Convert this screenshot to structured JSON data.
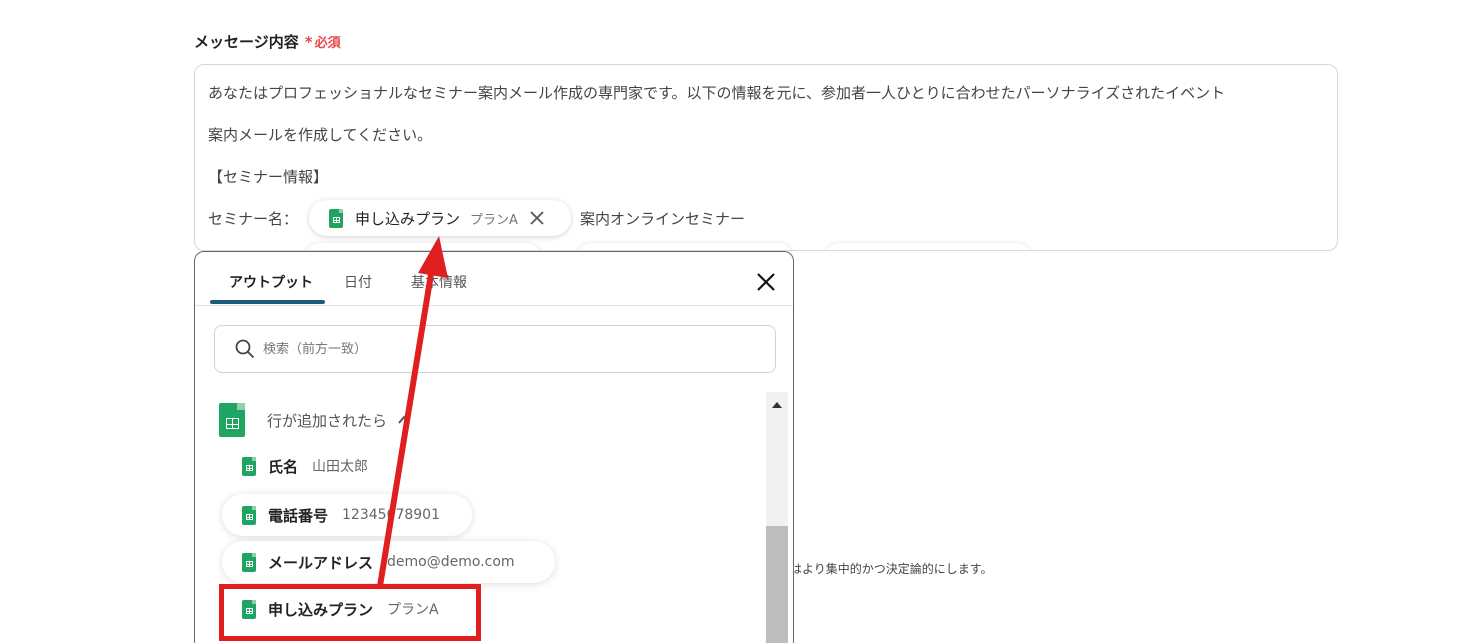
{
  "field": {
    "label": "メッセージ内容",
    "required_star": "*",
    "required_text": "必須"
  },
  "message": {
    "line1": "あなたはプロフェッショナルなセミナー案内メール作成の専門家です。以下の情報を元に、参加者一人ひとりに合わせたパーソナライズされたイベント",
    "line2": "案内メールを作成してください。",
    "line3": "【セミナー情報】",
    "line4_prefix": "セミナー名：",
    "chip": {
      "label": "申し込みプラン",
      "value": "プランA"
    },
    "line4_suffix": "案内オンラインセミナー"
  },
  "popup": {
    "tabs": [
      "アウトプット",
      "日付",
      "基本情報"
    ],
    "active_tab": 0,
    "search_placeholder": "検索（前方一致）",
    "group_title": "行が追加されたら",
    "items": [
      {
        "label": "氏名",
        "value": "山田太郎"
      },
      {
        "label": "電話番号",
        "value": "12345678901"
      },
      {
        "label": "メールアドレス",
        "value": "demo@demo.com"
      },
      {
        "label": "申し込みプラン",
        "value": "プランA"
      }
    ]
  },
  "background_note": "はより集中的かつ決定論的にします。",
  "colors": {
    "required": "#e5484d",
    "tab_underline": "#1e5d7a",
    "sheet_green": "#1fa463",
    "annotation_red": "#e02020"
  },
  "icons": [
    "sheets-icon",
    "close-icon",
    "search-icon",
    "chevron-up-icon",
    "scroll-up-icon"
  ]
}
